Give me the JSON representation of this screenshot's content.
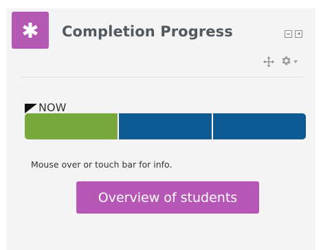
{
  "block": {
    "title": "Completion Progress",
    "icon": "asterisk-icon",
    "accent": "#b359b3"
  },
  "controls": {
    "minimize_icon": "minimize-icon",
    "dock_icon": "dock-icon",
    "move_icon": "move-icon",
    "settings_icon": "gear-icon"
  },
  "progress": {
    "now_label": "NOW",
    "segments": [
      {
        "state": "complete",
        "color": "#78a83e"
      },
      {
        "state": "incomplete",
        "color": "#0e5a93"
      },
      {
        "state": "incomplete",
        "color": "#0e5a93"
      }
    ],
    "hint": "Mouse over or touch bar for info."
  },
  "actions": {
    "overview_label": "Overview of students"
  }
}
